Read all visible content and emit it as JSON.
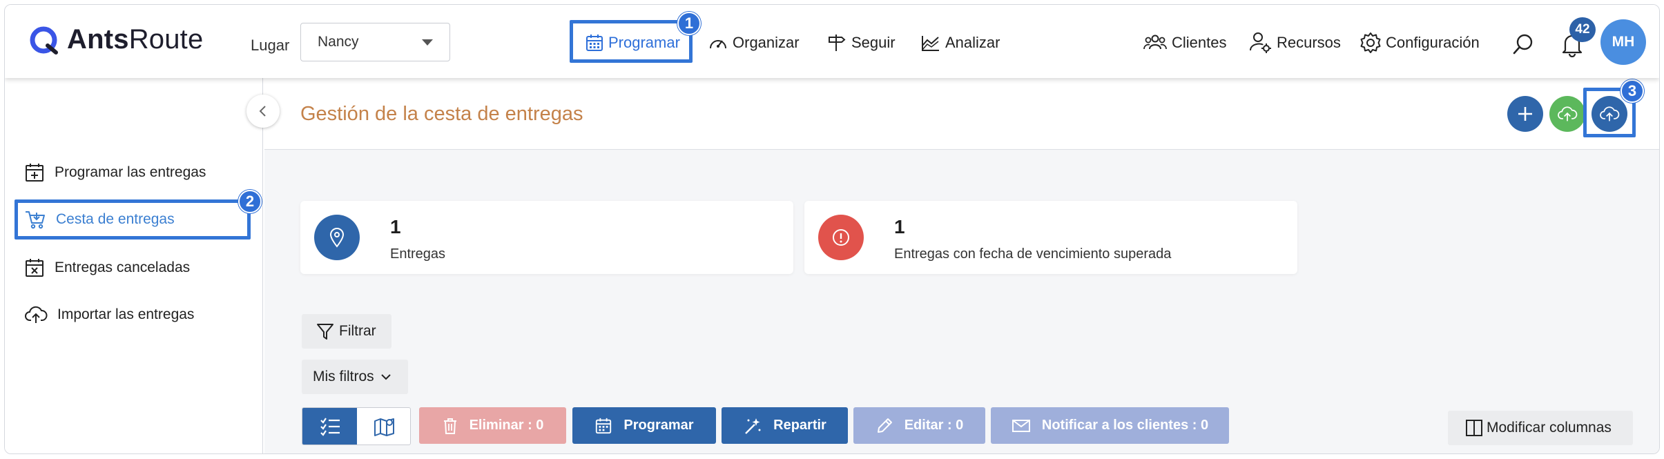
{
  "header": {
    "logo_bold": "Ants",
    "logo_light": "Route",
    "lugar_label": "Lugar",
    "lugar_value": "Nancy",
    "nav": {
      "programar": "Programar",
      "organizar": "Organizar",
      "seguir": "Seguir",
      "analizar": "Analizar",
      "clientes": "Clientes",
      "recursos": "Recursos",
      "configuracion": "Configuración"
    },
    "notification_count": "42",
    "avatar_initials": "MH"
  },
  "annotations": {
    "step1": "1",
    "step2": "2",
    "step3": "3"
  },
  "sidebar": {
    "items": [
      {
        "label": "Programar las entregas",
        "icon": "calendar-plus-icon"
      },
      {
        "label": "Cesta de entregas",
        "icon": "cart-icon"
      },
      {
        "label": "Entregas canceladas",
        "icon": "calendar-x-icon"
      },
      {
        "label": "Importar las entregas",
        "icon": "cloud-upload-icon"
      }
    ]
  },
  "main": {
    "title": "Gestión de la cesta de entregas",
    "cards": [
      {
        "count": "1",
        "label": "Entregas",
        "color": "#2f66aa"
      },
      {
        "count": "1",
        "label": "Entregas con fecha de vencimiento superada",
        "color": "#e1534c"
      }
    ],
    "filter_label": "Filtrar",
    "my_filters_label": "Mis filtros",
    "actions": {
      "eliminar": "Eliminar : 0",
      "programar": "Programar",
      "repartir": "Repartir",
      "editar": "Editar : 0",
      "notificar": "Notificar a los clientes : 0"
    },
    "modify_columns": "Modificar columnas"
  },
  "colors": {
    "primary": "#2f66aa",
    "accent_blue": "#3375d6",
    "title_orange": "#c4824a",
    "green": "#5cb85c",
    "danger_light": "#e8a6a6",
    "disabled_blue": "#9fafdb"
  }
}
